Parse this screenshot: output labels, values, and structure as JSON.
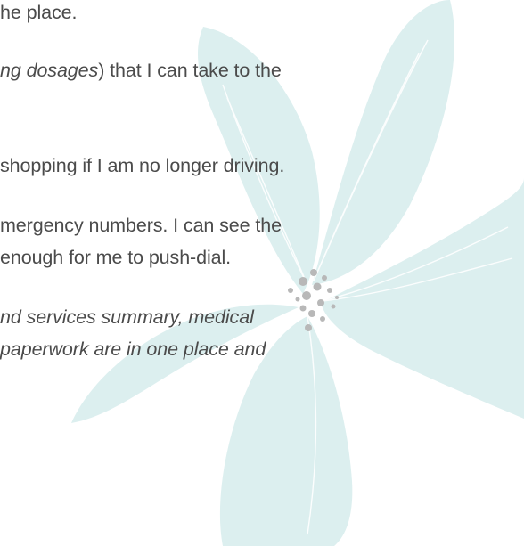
{
  "document": {
    "lines": {
      "l1": "he place.",
      "l2_italic": "ng dosages",
      "l2_rest": ") that I can take to the",
      "l3": "shopping if I am no longer driving.",
      "l4": "mergency numbers. I can see the",
      "l5": " enough for me to push-dial.",
      "l6": "nd services summary, medical",
      "l7": "paperwork are in one place and"
    }
  },
  "colors": {
    "text": "#4b4b4b",
    "petal": "#dcefef",
    "petal_vein": "#ffffff",
    "flower_center": "#b8b8b8"
  }
}
